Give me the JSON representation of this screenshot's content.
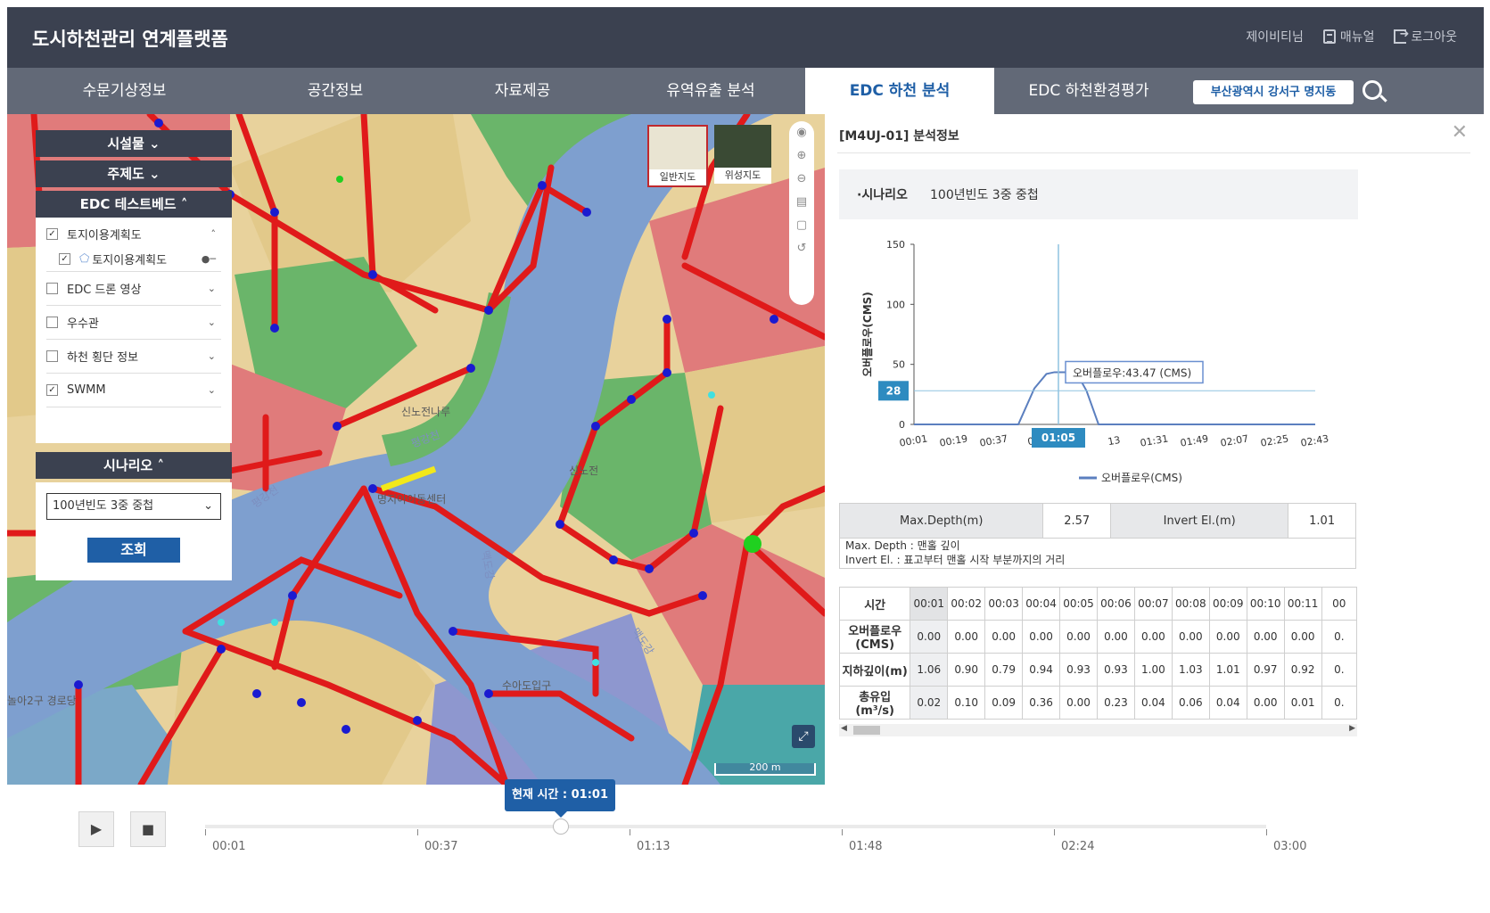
{
  "header": {
    "app_title": "도시하천관리 연계플랫폼",
    "user": "제이비티님",
    "manual": "매뉴얼",
    "logout": "로그아웃"
  },
  "nav": {
    "tabs": [
      {
        "label": "수문기상정보"
      },
      {
        "label": "공간정보"
      },
      {
        "label": "자료제공"
      },
      {
        "label": "유역유출 분석"
      },
      {
        "label": "EDC 하천 분석",
        "active": true
      },
      {
        "label": "EDC 하천환경평가"
      }
    ],
    "location": "부산광역시 강서구 명지동"
  },
  "map": {
    "sections": {
      "facility": "시설물",
      "theme": "주제도",
      "testbed": "EDC 테스트베드",
      "scenario": "시나리오"
    },
    "layers": [
      {
        "label": "토지이용계획도",
        "checked": true
      },
      {
        "label": "토지이용계획도",
        "checked": true
      },
      {
        "label": "EDC 드론 영상",
        "checked": false
      },
      {
        "label": "우수관",
        "checked": false
      },
      {
        "label": "하천 횡단 정보",
        "checked": false
      },
      {
        "label": "SWMM",
        "checked": true
      }
    ],
    "scenario_value": "100년빈도 3중 중첩",
    "query_button": "조회",
    "basemap": {
      "general": "일반지도",
      "satellite": "위성지도"
    },
    "scale": "200 m",
    "place_labels": [
      "신노전나루",
      "평강천",
      "신노전",
      "명지아이동센터",
      "맥도강",
      "평강천",
      "맥도강",
      "수아도입구",
      "놀아2구 경로당"
    ]
  },
  "panel": {
    "title": "[M4UJ-01] 분석정보",
    "scenario_key": "·시나리오",
    "scenario_value": "100년빈도 3중 중첩",
    "info": {
      "max_depth_label": "Max.Depth(m)",
      "max_depth_value": "2.57",
      "invert_label": "Invert El.(m)",
      "invert_value": "1.01",
      "note1": "Max. Depth : 맨홀 깊이",
      "note2": "Invert El. : 표고부터 맨홀 시작 부분까지의 거리"
    },
    "table": {
      "row_labels": [
        "시간",
        "오버플로우 (CMS)",
        "지하깊이(m)",
        "총유입(m³/s)"
      ],
      "times": [
        "00:01",
        "00:02",
        "00:03",
        "00:04",
        "00:05",
        "00:06",
        "00:07",
        "00:08",
        "00:09",
        "00:10",
        "00:11",
        "00"
      ],
      "overflow": [
        "0.00",
        "0.00",
        "0.00",
        "0.00",
        "0.00",
        "0.00",
        "0.00",
        "0.00",
        "0.00",
        "0.00",
        "0.00",
        "0."
      ],
      "depth": [
        "1.06",
        "0.90",
        "0.79",
        "0.94",
        "0.93",
        "0.93",
        "1.00",
        "1.03",
        "1.01",
        "0.97",
        "0.92",
        "0."
      ],
      "inflow": [
        "0.02",
        "0.10",
        "0.09",
        "0.36",
        "0.00",
        "0.23",
        "0.04",
        "0.06",
        "0.04",
        "0.00",
        "0.01",
        "0."
      ]
    }
  },
  "chart_data": {
    "type": "line",
    "ylabel": "오버플로우(CMS)",
    "ylim": [
      0,
      150
    ],
    "yticks": [
      0,
      50,
      100,
      150
    ],
    "x_tick_labels": [
      "00:01",
      "00:19",
      "00:37",
      "00",
      "01:05",
      "13",
      "01:31",
      "01:49",
      "02:07",
      "02:25",
      "02:43"
    ],
    "series": [
      {
        "name": "오버플로우(CMS)",
        "color": "#5b7fbf",
        "x": [
          0,
          0.19,
          0.26,
          0.3,
          0.33,
          0.35,
          0.38,
          0.41,
          0.43,
          0.46,
          1.0
        ],
        "values": [
          0,
          0,
          0,
          30,
          42,
          43.47,
          43.47,
          40,
          28,
          0,
          0
        ]
      }
    ],
    "cursor_label": "01:05",
    "y_marker": "28",
    "tooltip": "오버플로우:43.47 (CMS)"
  },
  "timeline": {
    "current_time": "현재 시간 : 01:01",
    "labels": [
      "00:01",
      "00:37",
      "01:13",
      "01:48",
      "02:24",
      "03:00"
    ]
  },
  "colors": {
    "header": "#3b4150",
    "nav": "#626977",
    "accent": "#1f5fa6"
  }
}
